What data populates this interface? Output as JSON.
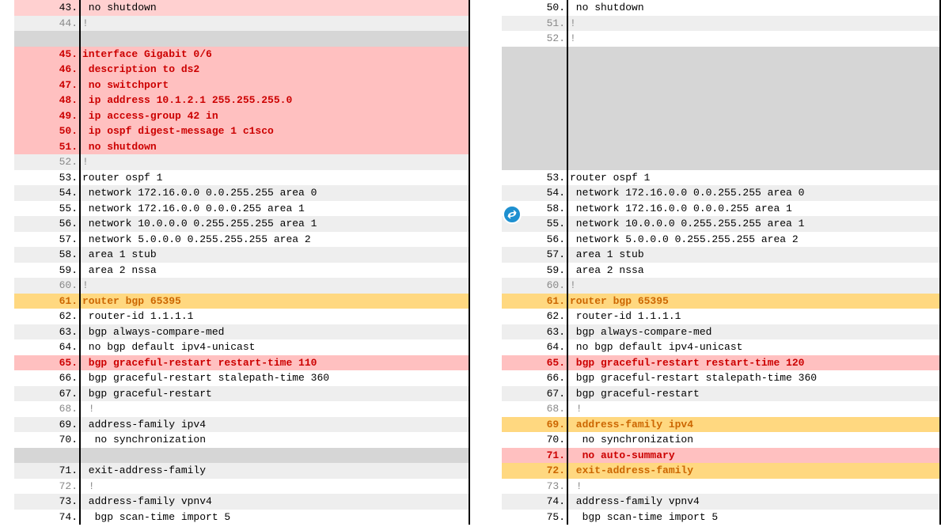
{
  "left": [
    {
      "n": "43.",
      "t": " no shutdown",
      "row_bg": "bg-pink2",
      "ln_bg": "",
      "fg": "fg-black"
    },
    {
      "n": "44.",
      "t": "!",
      "row_bg": "bg-zebra",
      "ln_bg": "",
      "fg": "fg-gray"
    },
    {
      "n": "",
      "t": "",
      "row_bg": "bg-gray",
      "ln_bg": "",
      "fg": "fg-black"
    },
    {
      "n": "45.",
      "t": "interface Gigabit 0/6",
      "row_bg": "bg-pink",
      "ln_bg": "",
      "fg": "fg-red"
    },
    {
      "n": "46.",
      "t": " description to ds2",
      "row_bg": "bg-pink",
      "ln_bg": "",
      "fg": "fg-red"
    },
    {
      "n": "47.",
      "t": " no switchport",
      "row_bg": "bg-pink",
      "ln_bg": "",
      "fg": "fg-red"
    },
    {
      "n": "48.",
      "t": " ip address 10.1.2.1 255.255.255.0",
      "row_bg": "bg-pink",
      "ln_bg": "",
      "fg": "fg-red"
    },
    {
      "n": "49.",
      "t": " ip access-group 42 in",
      "row_bg": "bg-pink",
      "ln_bg": "",
      "fg": "fg-red"
    },
    {
      "n": "50.",
      "t": " ip ospf digest-message 1 c1sco",
      "row_bg": "bg-pink",
      "ln_bg": "",
      "fg": "fg-red"
    },
    {
      "n": "51.",
      "t": " no shutdown",
      "row_bg": "bg-pink",
      "ln_bg": "",
      "fg": "fg-red"
    },
    {
      "n": "52.",
      "t": "!",
      "row_bg": "bg-zebra",
      "ln_bg": "",
      "fg": "fg-gray"
    },
    {
      "n": "53.",
      "t": "router ospf 1",
      "row_bg": "bg-white",
      "ln_bg": "",
      "fg": "fg-black"
    },
    {
      "n": "54.",
      "t": " network 172.16.0.0 0.0.255.255 area 0",
      "row_bg": "bg-zebra",
      "ln_bg": "",
      "fg": "fg-black"
    },
    {
      "n": "55.",
      "t": " network 172.16.0.0 0.0.0.255 area 1",
      "row_bg": "bg-white",
      "ln_bg": "",
      "fg": "fg-black"
    },
    {
      "n": "56.",
      "t": " network 10.0.0.0 0.255.255.255 area 1",
      "row_bg": "bg-zebra",
      "ln_bg": "",
      "fg": "fg-black"
    },
    {
      "n": "57.",
      "t": " network 5.0.0.0 0.255.255.255 area 2",
      "row_bg": "bg-white",
      "ln_bg": "",
      "fg": "fg-black"
    },
    {
      "n": "58.",
      "t": " area 1 stub",
      "row_bg": "bg-zebra",
      "ln_bg": "",
      "fg": "fg-black"
    },
    {
      "n": "59.",
      "t": " area 2 nssa",
      "row_bg": "bg-white",
      "ln_bg": "",
      "fg": "fg-black"
    },
    {
      "n": "60.",
      "t": "!",
      "row_bg": "bg-zebra",
      "ln_bg": "",
      "fg": "fg-gray"
    },
    {
      "n": "61.",
      "t": "router bgp 65395",
      "row_bg": "bg-orange",
      "ln_bg": "",
      "fg": "fg-orange"
    },
    {
      "n": "62.",
      "t": " router-id 1.1.1.1",
      "row_bg": "bg-white",
      "ln_bg": "",
      "fg": "fg-black"
    },
    {
      "n": "63.",
      "t": " bgp always-compare-med",
      "row_bg": "bg-zebra",
      "ln_bg": "",
      "fg": "fg-black"
    },
    {
      "n": "64.",
      "t": " no bgp default ipv4-unicast",
      "row_bg": "bg-white",
      "ln_bg": "",
      "fg": "fg-black"
    },
    {
      "n": "65.",
      "t": " bgp graceful-restart restart-time 110",
      "row_bg": "bg-pink",
      "ln_bg": "",
      "fg": "fg-red"
    },
    {
      "n": "66.",
      "t": " bgp graceful-restart stalepath-time 360",
      "row_bg": "bg-white",
      "ln_bg": "",
      "fg": "fg-black"
    },
    {
      "n": "67.",
      "t": " bgp graceful-restart",
      "row_bg": "bg-zebra",
      "ln_bg": "",
      "fg": "fg-black"
    },
    {
      "n": "68.",
      "t": " !",
      "row_bg": "bg-white",
      "ln_bg": "",
      "fg": "fg-gray"
    },
    {
      "n": "69.",
      "t": " address-family ipv4",
      "row_bg": "bg-zebra",
      "ln_bg": "",
      "fg": "fg-black"
    },
    {
      "n": "70.",
      "t": "  no synchronization",
      "row_bg": "bg-white",
      "ln_bg": "",
      "fg": "fg-black"
    },
    {
      "n": "",
      "t": "",
      "row_bg": "bg-gray",
      "ln_bg": "",
      "fg": "fg-black"
    },
    {
      "n": "71.",
      "t": " exit-address-family",
      "row_bg": "bg-zebra",
      "ln_bg": "",
      "fg": "fg-black"
    },
    {
      "n": "72.",
      "t": " !",
      "row_bg": "bg-white",
      "ln_bg": "",
      "fg": "fg-gray"
    },
    {
      "n": "73.",
      "t": " address-family vpnv4",
      "row_bg": "bg-zebra",
      "ln_bg": "",
      "fg": "fg-black"
    },
    {
      "n": "74.",
      "t": "  bgp scan-time import 5",
      "row_bg": "bg-white",
      "ln_bg": "",
      "fg": "fg-black"
    }
  ],
  "right": [
    {
      "n": "50.",
      "t": " no shutdown",
      "row_bg": "bg-white",
      "fg": "fg-black"
    },
    {
      "n": "51.",
      "t": "!",
      "row_bg": "bg-zebra",
      "fg": "fg-gray"
    },
    {
      "n": "52.",
      "t": "!",
      "row_bg": "bg-white",
      "fg": "fg-gray"
    },
    {
      "n": "",
      "t": "",
      "row_bg": "bg-gray",
      "fg": "fg-black"
    },
    {
      "n": "",
      "t": "",
      "row_bg": "bg-gray",
      "fg": "fg-black"
    },
    {
      "n": "",
      "t": "",
      "row_bg": "bg-gray",
      "fg": "fg-black"
    },
    {
      "n": "",
      "t": "",
      "row_bg": "bg-gray",
      "fg": "fg-black"
    },
    {
      "n": "",
      "t": "",
      "row_bg": "bg-gray",
      "fg": "fg-black"
    },
    {
      "n": "",
      "t": "",
      "row_bg": "bg-gray",
      "fg": "fg-black"
    },
    {
      "n": "",
      "t": "",
      "row_bg": "bg-gray",
      "fg": "fg-black"
    },
    {
      "n": "",
      "t": "",
      "row_bg": "bg-gray",
      "fg": "fg-black"
    },
    {
      "n": "53.",
      "t": "router ospf 1",
      "row_bg": "bg-white",
      "fg": "fg-black"
    },
    {
      "n": "54.",
      "t": " network 172.16.0.0 0.0.255.255 area 0",
      "row_bg": "bg-zebra",
      "fg": "fg-black"
    },
    {
      "n": "58.",
      "t": " network 172.16.0.0 0.0.0.255 area 1",
      "row_bg": "bg-white",
      "fg": "fg-black"
    },
    {
      "n": "55.",
      "t": " network 10.0.0.0 0.255.255.255 area 1",
      "row_bg": "bg-zebra",
      "fg": "fg-black"
    },
    {
      "n": "56.",
      "t": " network 5.0.0.0 0.255.255.255 area 2",
      "row_bg": "bg-white",
      "fg": "fg-black"
    },
    {
      "n": "57.",
      "t": " area 1 stub",
      "row_bg": "bg-zebra",
      "fg": "fg-black"
    },
    {
      "n": "59.",
      "t": " area 2 nssa",
      "row_bg": "bg-white",
      "fg": "fg-black"
    },
    {
      "n": "60.",
      "t": "!",
      "row_bg": "bg-zebra",
      "fg": "fg-gray"
    },
    {
      "n": "61.",
      "t": "router bgp 65395",
      "row_bg": "bg-orange",
      "fg": "fg-orange"
    },
    {
      "n": "62.",
      "t": " router-id 1.1.1.1",
      "row_bg": "bg-white",
      "fg": "fg-black"
    },
    {
      "n": "63.",
      "t": " bgp always-compare-med",
      "row_bg": "bg-zebra",
      "fg": "fg-black"
    },
    {
      "n": "64.",
      "t": " no bgp default ipv4-unicast",
      "row_bg": "bg-white",
      "fg": "fg-black"
    },
    {
      "n": "65.",
      "t": " bgp graceful-restart restart-time 120",
      "row_bg": "bg-pink",
      "fg": "fg-red"
    },
    {
      "n": "66.",
      "t": " bgp graceful-restart stalepath-time 360",
      "row_bg": "bg-white",
      "fg": "fg-black"
    },
    {
      "n": "67.",
      "t": " bgp graceful-restart",
      "row_bg": "bg-zebra",
      "fg": "fg-black"
    },
    {
      "n": "68.",
      "t": " !",
      "row_bg": "bg-white",
      "fg": "fg-gray"
    },
    {
      "n": "69.",
      "t": " address-family ipv4",
      "row_bg": "bg-orange",
      "fg": "fg-orange"
    },
    {
      "n": "70.",
      "t": "  no synchronization",
      "row_bg": "bg-white",
      "fg": "fg-black"
    },
    {
      "n": "71.",
      "t": "  no auto-summary",
      "row_bg": "bg-pink",
      "fg": "fg-red"
    },
    {
      "n": "72.",
      "t": " exit-address-family",
      "row_bg": "bg-orange",
      "fg": "fg-orange"
    },
    {
      "n": "73.",
      "t": " !",
      "row_bg": "bg-white",
      "fg": "fg-gray"
    },
    {
      "n": "74.",
      "t": " address-family vpnv4",
      "row_bg": "bg-zebra",
      "fg": "fg-black"
    },
    {
      "n": "75.",
      "t": "  bgp scan-time import 5",
      "row_bg": "bg-white",
      "fg": "fg-black"
    }
  ]
}
